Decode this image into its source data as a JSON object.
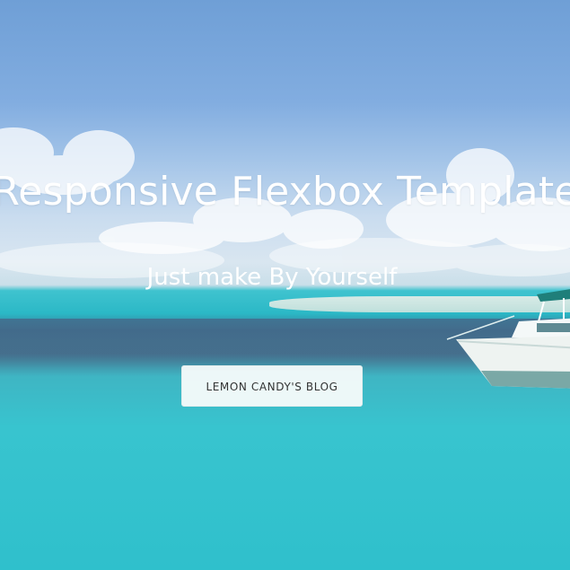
{
  "hero": {
    "title": "Responsive Flexbox Template",
    "subtitle": "Just make By Yourself",
    "button_label": "LEMON CANDY'S BLOG"
  },
  "colors": {
    "text": "#ffffff",
    "button_background": "#f7fbfb",
    "button_text": "#333333",
    "sky": "#82ade0",
    "sea": "#38c4cf"
  },
  "background": {
    "description_icon": "beach-boat-photo"
  }
}
